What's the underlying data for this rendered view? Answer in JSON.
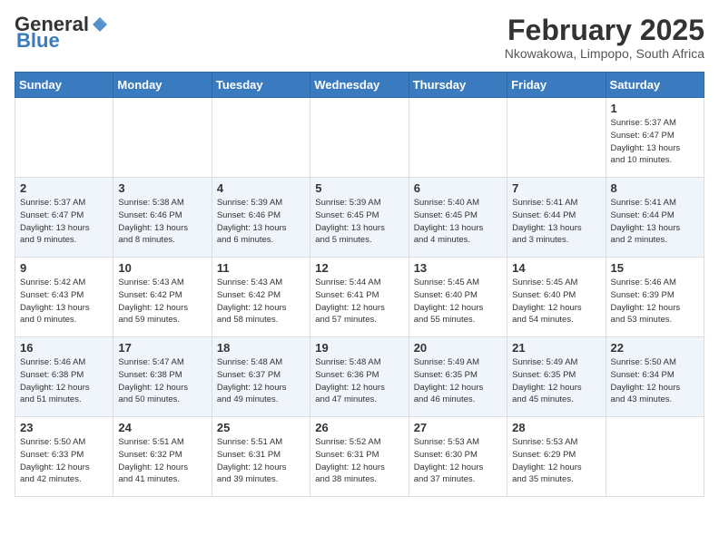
{
  "header": {
    "logo_general": "General",
    "logo_blue": "Blue",
    "month_title": "February 2025",
    "location": "Nkowakowa, Limpopo, South Africa"
  },
  "days_of_week": [
    "Sunday",
    "Monday",
    "Tuesday",
    "Wednesday",
    "Thursday",
    "Friday",
    "Saturday"
  ],
  "weeks": [
    [
      {
        "day": "",
        "info": ""
      },
      {
        "day": "",
        "info": ""
      },
      {
        "day": "",
        "info": ""
      },
      {
        "day": "",
        "info": ""
      },
      {
        "day": "",
        "info": ""
      },
      {
        "day": "",
        "info": ""
      },
      {
        "day": "1",
        "info": "Sunrise: 5:37 AM\nSunset: 6:47 PM\nDaylight: 13 hours\nand 10 minutes."
      }
    ],
    [
      {
        "day": "2",
        "info": "Sunrise: 5:37 AM\nSunset: 6:47 PM\nDaylight: 13 hours\nand 9 minutes."
      },
      {
        "day": "3",
        "info": "Sunrise: 5:38 AM\nSunset: 6:46 PM\nDaylight: 13 hours\nand 8 minutes."
      },
      {
        "day": "4",
        "info": "Sunrise: 5:39 AM\nSunset: 6:46 PM\nDaylight: 13 hours\nand 6 minutes."
      },
      {
        "day": "5",
        "info": "Sunrise: 5:39 AM\nSunset: 6:45 PM\nDaylight: 13 hours\nand 5 minutes."
      },
      {
        "day": "6",
        "info": "Sunrise: 5:40 AM\nSunset: 6:45 PM\nDaylight: 13 hours\nand 4 minutes."
      },
      {
        "day": "7",
        "info": "Sunrise: 5:41 AM\nSunset: 6:44 PM\nDaylight: 13 hours\nand 3 minutes."
      },
      {
        "day": "8",
        "info": "Sunrise: 5:41 AM\nSunset: 6:44 PM\nDaylight: 13 hours\nand 2 minutes."
      }
    ],
    [
      {
        "day": "9",
        "info": "Sunrise: 5:42 AM\nSunset: 6:43 PM\nDaylight: 13 hours\nand 0 minutes."
      },
      {
        "day": "10",
        "info": "Sunrise: 5:43 AM\nSunset: 6:42 PM\nDaylight: 12 hours\nand 59 minutes."
      },
      {
        "day": "11",
        "info": "Sunrise: 5:43 AM\nSunset: 6:42 PM\nDaylight: 12 hours\nand 58 minutes."
      },
      {
        "day": "12",
        "info": "Sunrise: 5:44 AM\nSunset: 6:41 PM\nDaylight: 12 hours\nand 57 minutes."
      },
      {
        "day": "13",
        "info": "Sunrise: 5:45 AM\nSunset: 6:40 PM\nDaylight: 12 hours\nand 55 minutes."
      },
      {
        "day": "14",
        "info": "Sunrise: 5:45 AM\nSunset: 6:40 PM\nDaylight: 12 hours\nand 54 minutes."
      },
      {
        "day": "15",
        "info": "Sunrise: 5:46 AM\nSunset: 6:39 PM\nDaylight: 12 hours\nand 53 minutes."
      }
    ],
    [
      {
        "day": "16",
        "info": "Sunrise: 5:46 AM\nSunset: 6:38 PM\nDaylight: 12 hours\nand 51 minutes."
      },
      {
        "day": "17",
        "info": "Sunrise: 5:47 AM\nSunset: 6:38 PM\nDaylight: 12 hours\nand 50 minutes."
      },
      {
        "day": "18",
        "info": "Sunrise: 5:48 AM\nSunset: 6:37 PM\nDaylight: 12 hours\nand 49 minutes."
      },
      {
        "day": "19",
        "info": "Sunrise: 5:48 AM\nSunset: 6:36 PM\nDaylight: 12 hours\nand 47 minutes."
      },
      {
        "day": "20",
        "info": "Sunrise: 5:49 AM\nSunset: 6:35 PM\nDaylight: 12 hours\nand 46 minutes."
      },
      {
        "day": "21",
        "info": "Sunrise: 5:49 AM\nSunset: 6:35 PM\nDaylight: 12 hours\nand 45 minutes."
      },
      {
        "day": "22",
        "info": "Sunrise: 5:50 AM\nSunset: 6:34 PM\nDaylight: 12 hours\nand 43 minutes."
      }
    ],
    [
      {
        "day": "23",
        "info": "Sunrise: 5:50 AM\nSunset: 6:33 PM\nDaylight: 12 hours\nand 42 minutes."
      },
      {
        "day": "24",
        "info": "Sunrise: 5:51 AM\nSunset: 6:32 PM\nDaylight: 12 hours\nand 41 minutes."
      },
      {
        "day": "25",
        "info": "Sunrise: 5:51 AM\nSunset: 6:31 PM\nDaylight: 12 hours\nand 39 minutes."
      },
      {
        "day": "26",
        "info": "Sunrise: 5:52 AM\nSunset: 6:31 PM\nDaylight: 12 hours\nand 38 minutes."
      },
      {
        "day": "27",
        "info": "Sunrise: 5:53 AM\nSunset: 6:30 PM\nDaylight: 12 hours\nand 37 minutes."
      },
      {
        "day": "28",
        "info": "Sunrise: 5:53 AM\nSunset: 6:29 PM\nDaylight: 12 hours\nand 35 minutes."
      },
      {
        "day": "",
        "info": ""
      }
    ]
  ]
}
